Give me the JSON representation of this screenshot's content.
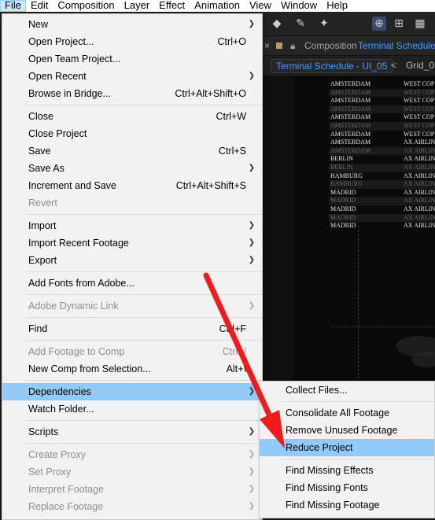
{
  "menubar": [
    "File",
    "Edit",
    "Composition",
    "Layer",
    "Effect",
    "Animation",
    "View",
    "Window",
    "Help"
  ],
  "panel": {
    "close": "×",
    "title_prefix": "Composition",
    "comp_name": "Terminal Schedule -",
    "tab_active": "Terminal Schedule - UI_05",
    "tab_other": "Grid_03",
    "tab_arrow": "<"
  },
  "schedule_rows": [
    {
      "city": "AMSTERDAM",
      "air": "WEST COP",
      "dim": false
    },
    {
      "city": "AMSTERDAM",
      "air": "WEST COP",
      "dim": true
    },
    {
      "city": "AMSTERDAM",
      "air": "WEST COP",
      "dim": false
    },
    {
      "city": "AMSTERDAM",
      "air": "WEST COP",
      "dim": true
    },
    {
      "city": "AMSTERDAM",
      "air": "WEST COP",
      "dim": false
    },
    {
      "city": "AMSTERDAM",
      "air": "WEST COP",
      "dim": true
    },
    {
      "city": "AMSTERDAM",
      "air": "WEST COP",
      "dim": false
    },
    {
      "city": "AMSTERDAM",
      "air": "AX AIRLIN",
      "dim": false
    },
    {
      "city": "AMSTERDAM",
      "air": "AX AIRLIN",
      "dim": true
    },
    {
      "city": "BERLIN",
      "air": "AX AIRLIN",
      "dim": false
    },
    {
      "city": "BERLIN",
      "air": "AX AIRLIN",
      "dim": true
    },
    {
      "city": "HAMBURG",
      "air": "AX AIRLIN",
      "dim": false
    },
    {
      "city": "HAMBURG",
      "air": "AX AIRLIN",
      "dim": true
    },
    {
      "city": "MADRID",
      "air": "AX AIRLIN",
      "dim": false
    },
    {
      "city": "MADRID",
      "air": "AX AIRLIN",
      "dim": true
    },
    {
      "city": "MADRID",
      "air": "AX AIRLIN",
      "dim": false
    },
    {
      "city": "MADRID",
      "air": "AX AIRLIN",
      "dim": true
    },
    {
      "city": "MADRID",
      "air": "AX AIRLIN",
      "dim": false
    }
  ],
  "file_menu": [
    {
      "label": "New",
      "arrow": true
    },
    {
      "label": "Open Project...",
      "shortcut": "Ctrl+O"
    },
    {
      "label": "Open Team Project..."
    },
    {
      "label": "Open Recent",
      "arrow": true
    },
    {
      "label": "Browse in Bridge...",
      "shortcut": "Ctrl+Alt+Shift+O"
    },
    {
      "sep": true
    },
    {
      "label": "Close",
      "shortcut": "Ctrl+W"
    },
    {
      "label": "Close Project"
    },
    {
      "label": "Save",
      "shortcut": "Ctrl+S"
    },
    {
      "label": "Save As",
      "arrow": true
    },
    {
      "label": "Increment and Save",
      "shortcut": "Ctrl+Alt+Shift+S"
    },
    {
      "label": "Revert",
      "disabled": true
    },
    {
      "sep": true
    },
    {
      "label": "Import",
      "arrow": true
    },
    {
      "label": "Import Recent Footage",
      "arrow": true
    },
    {
      "label": "Export",
      "arrow": true
    },
    {
      "sep": true
    },
    {
      "label": "Add Fonts from Adobe..."
    },
    {
      "sep": true
    },
    {
      "label": "Adobe Dynamic Link",
      "arrow": true,
      "disabled": true
    },
    {
      "sep": true
    },
    {
      "label": "Find",
      "shortcut": "Ctrl+F"
    },
    {
      "sep": true
    },
    {
      "label": "Add Footage to Comp",
      "shortcut": "Ctrl+/",
      "disabled": true
    },
    {
      "label": "New Comp from Selection...",
      "shortcut": "Alt+\\"
    },
    {
      "sep": true
    },
    {
      "label": "Dependencies",
      "arrow": true,
      "highlight": true
    },
    {
      "label": "Watch Folder..."
    },
    {
      "sep": true
    },
    {
      "label": "Scripts",
      "arrow": true
    },
    {
      "sep": true
    },
    {
      "label": "Create Proxy",
      "arrow": true,
      "disabled": true
    },
    {
      "label": "Set Proxy",
      "arrow": true,
      "disabled": true
    },
    {
      "label": "Interpret Footage",
      "arrow": true,
      "disabled": true
    },
    {
      "label": "Replace Footage",
      "arrow": true,
      "disabled": true
    }
  ],
  "dependencies_menu": [
    {
      "label": "Collect Files..."
    },
    {
      "sep": true
    },
    {
      "label": "Consolidate All Footage"
    },
    {
      "label": "Remove Unused Footage"
    },
    {
      "label": "Reduce Project",
      "highlight": true
    },
    {
      "sep": true
    },
    {
      "label": "Find Missing Effects"
    },
    {
      "label": "Find Missing Fonts"
    },
    {
      "label": "Find Missing Footage"
    }
  ],
  "annotation": {
    "color": "#ee1c1c"
  }
}
